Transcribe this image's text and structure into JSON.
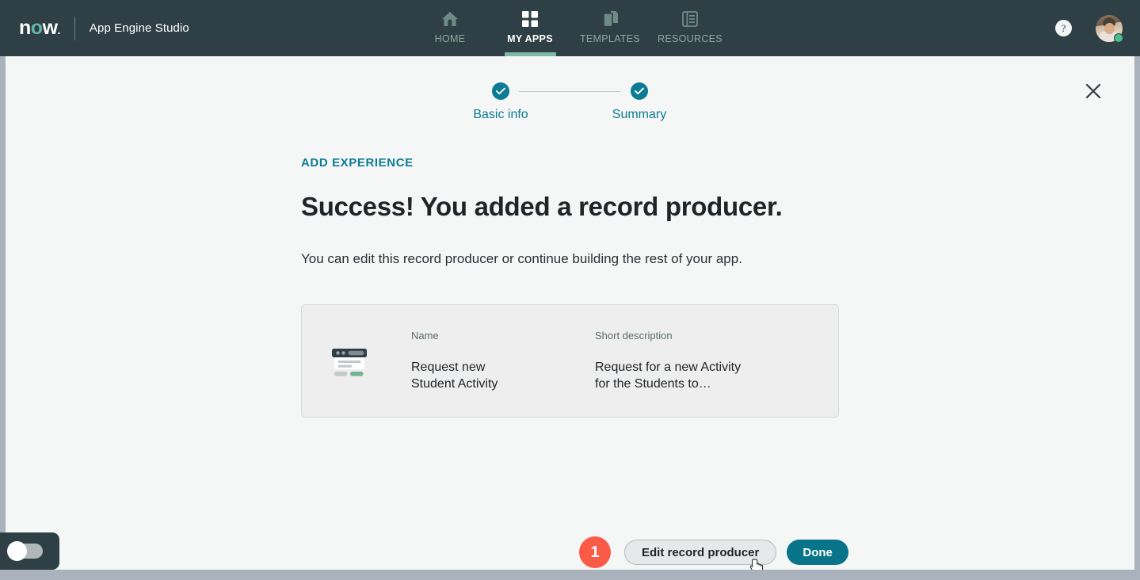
{
  "topbar": {
    "logo": {
      "pre": "n",
      "mid": "o",
      "post": "w",
      "dot": "."
    },
    "product_title": "App Engine Studio",
    "nav": [
      {
        "label": "HOME",
        "icon": "home-icon",
        "active": false
      },
      {
        "label": "MY APPS",
        "icon": "grid-icon",
        "active": true
      },
      {
        "label": "TEMPLATES",
        "icon": "templates-icon",
        "active": false
      },
      {
        "label": "RESOURCES",
        "icon": "resources-icon",
        "active": false
      }
    ],
    "help_label": "?",
    "avatar_status": "online",
    "active_underline_color": "#7fb8a4",
    "background_color": "#2e4045"
  },
  "panel": {
    "close_label": "✕",
    "stepper": [
      {
        "label": "Basic info",
        "state": "complete"
      },
      {
        "label": "Summary",
        "state": "complete"
      }
    ],
    "stepper_accent": "#0c7b93"
  },
  "content": {
    "eyebrow": "ADD EXPERIENCE",
    "headline": "Success! You added a record producer.",
    "subtext": "You can edit this record producer or continue building the rest of your app.",
    "card": {
      "icon": "record-producer-icon",
      "fields": [
        {
          "label": "Name",
          "value": "Request new Student Activity"
        },
        {
          "label": "Short description",
          "value": "Request for a new Activity for the Students to…"
        }
      ]
    }
  },
  "actions": {
    "badge": "1",
    "badge_color": "#fb5a47",
    "secondary_label": "Edit record producer",
    "primary_label": "Done",
    "primary_color": "#08748a"
  },
  "footer": {
    "toggle_state": "off"
  }
}
